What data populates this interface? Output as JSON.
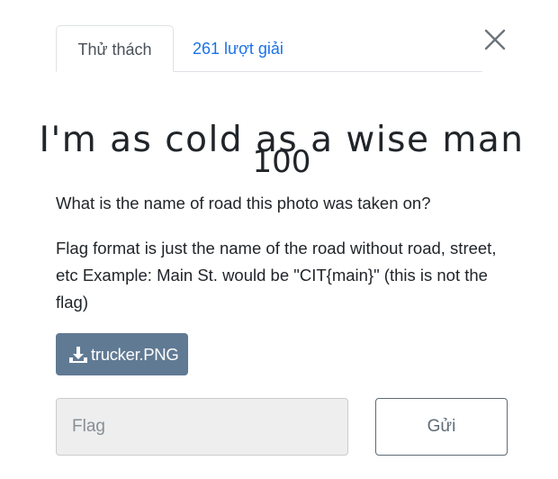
{
  "tabs": {
    "challenge_label": "Thử thách",
    "solves_label": "261 lượt giải"
  },
  "challenge": {
    "title": "I'm as cold as a wise man",
    "points": "100",
    "description_1": "What is the name of road this photo was taken on?",
    "description_2": "Flag format is just the name of the road without road, street, etc Example: Main St. would be \"CIT{main}\" (this is not the flag)"
  },
  "file": {
    "name": "trucker.PNG",
    "icon": "download-icon"
  },
  "form": {
    "flag_placeholder": "Flag",
    "flag_value": "",
    "submit_label": "Gửi"
  },
  "colors": {
    "link": "#1a73e8",
    "file_button": "#607a94",
    "input_bg": "#eeeeee"
  }
}
